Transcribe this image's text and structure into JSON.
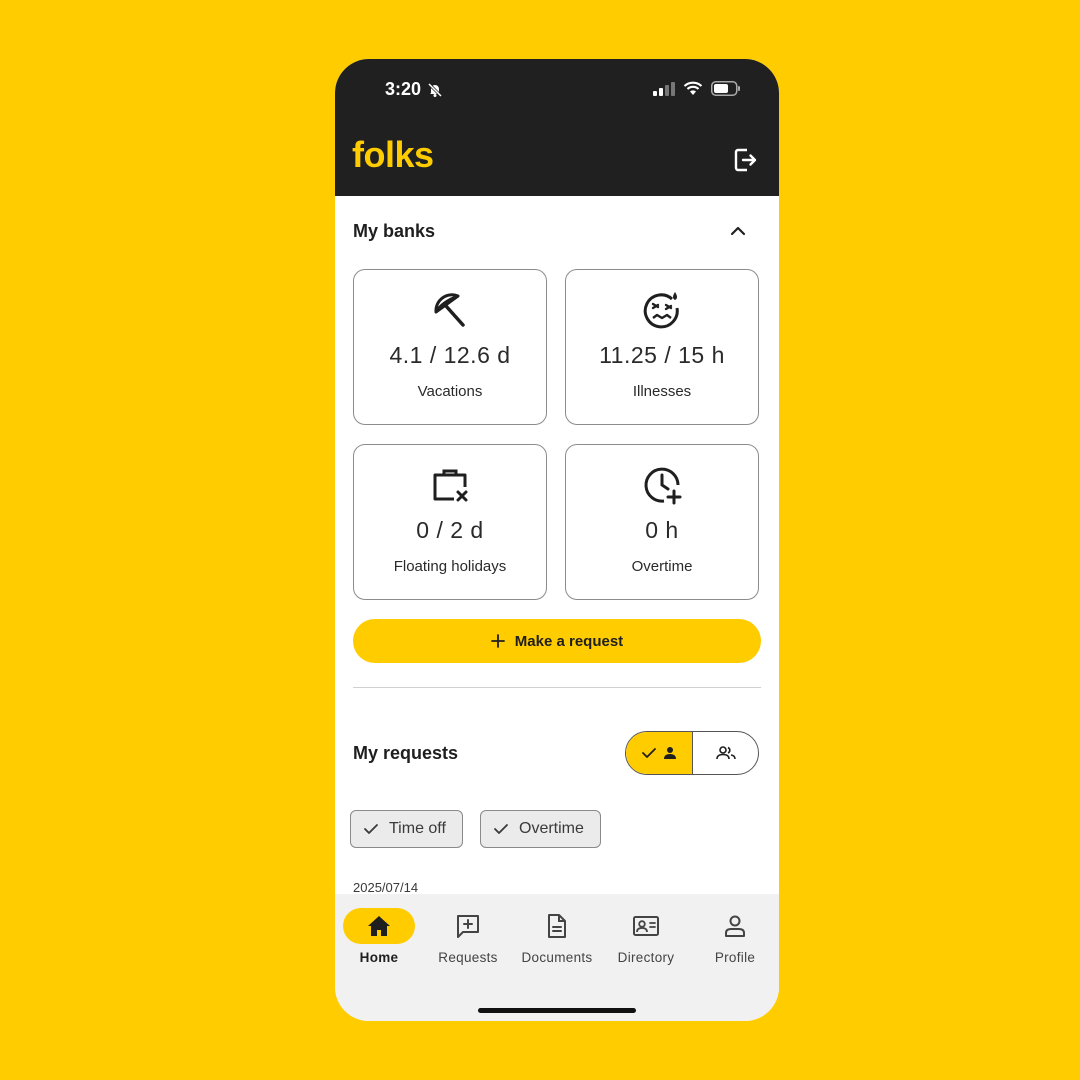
{
  "status_bar": {
    "time": "3:20"
  },
  "app": {
    "brand": "folks"
  },
  "banks": {
    "title": "My banks",
    "cards": [
      {
        "value": "4.1 / 12.6 d",
        "label": "Vacations",
        "icon": "beach-umbrella-icon"
      },
      {
        "value": "11.25 / 15 h",
        "label": "Illnesses",
        "icon": "sick-face-icon"
      },
      {
        "value": "0 / 2 d",
        "label": "Floating holidays",
        "icon": "briefcase-x-icon"
      },
      {
        "value": "0 h",
        "label": "Overtime",
        "icon": "clock-plus-icon"
      }
    ],
    "request_button": "Make a request"
  },
  "requests": {
    "title": "My requests",
    "filters": [
      {
        "label": "Time off",
        "checked": true
      },
      {
        "label": "Overtime",
        "checked": true
      }
    ],
    "first_date": "2025/07/14"
  },
  "nav": {
    "items": [
      {
        "label": "Home",
        "icon": "home-icon",
        "active": true
      },
      {
        "label": "Requests",
        "icon": "requests-icon",
        "active": false
      },
      {
        "label": "Documents",
        "icon": "document-icon",
        "active": false
      },
      {
        "label": "Directory",
        "icon": "directory-icon",
        "active": false
      },
      {
        "label": "Profile",
        "icon": "profile-icon",
        "active": false
      }
    ]
  },
  "colors": {
    "accent": "#FFCC00",
    "dark": "#202020",
    "background": "#FFCC00"
  }
}
